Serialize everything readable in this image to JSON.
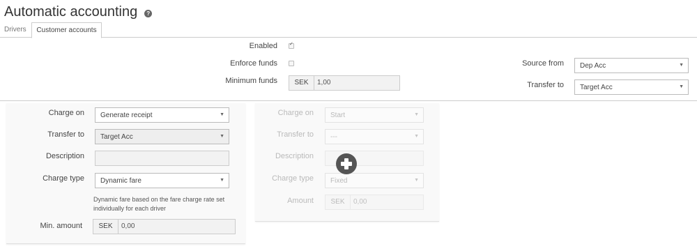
{
  "header": {
    "title": "Automatic accounting",
    "help_icon": "?"
  },
  "tabs": [
    {
      "label": "Drivers",
      "active": false
    },
    {
      "label": "Customer accounts",
      "active": true
    }
  ],
  "settings": {
    "enabled_label": "Enabled",
    "enabled_checked": true,
    "enforce_funds_label": "Enforce funds",
    "enforce_funds_checked": false,
    "minimum_funds_label": "Minimum funds",
    "minimum_funds_currency": "SEK",
    "minimum_funds_value": "1,00",
    "source_from_label": "Source from",
    "source_from_value": "Dep Acc",
    "transfer_to_label": "Transfer to",
    "transfer_to_value": "Target Acc"
  },
  "rule_card": {
    "charge_on_label": "Charge on",
    "charge_on_value": "Generate receipt",
    "transfer_to_label": "Transfer to",
    "transfer_to_value": "Target Acc",
    "description_label": "Description",
    "description_value": "",
    "charge_type_label": "Charge type",
    "charge_type_value": "Dynamic fare",
    "charge_type_note": "Dynamic fare based on the fare charge rate set individually for each driver",
    "min_amount_label": "Min. amount",
    "min_amount_currency": "SEK",
    "min_amount_value": "0,00"
  },
  "new_rule_card": {
    "charge_on_label": "Charge on",
    "charge_on_value": "Start",
    "transfer_to_label": "Transfer to",
    "transfer_to_value": "---",
    "description_label": "Description",
    "description_value": "",
    "charge_type_label": "Charge type",
    "charge_type_value": "Fixed",
    "amount_label": "Amount",
    "amount_currency": "SEK",
    "amount_value": "0,00"
  },
  "add_icon": "plus-circle"
}
